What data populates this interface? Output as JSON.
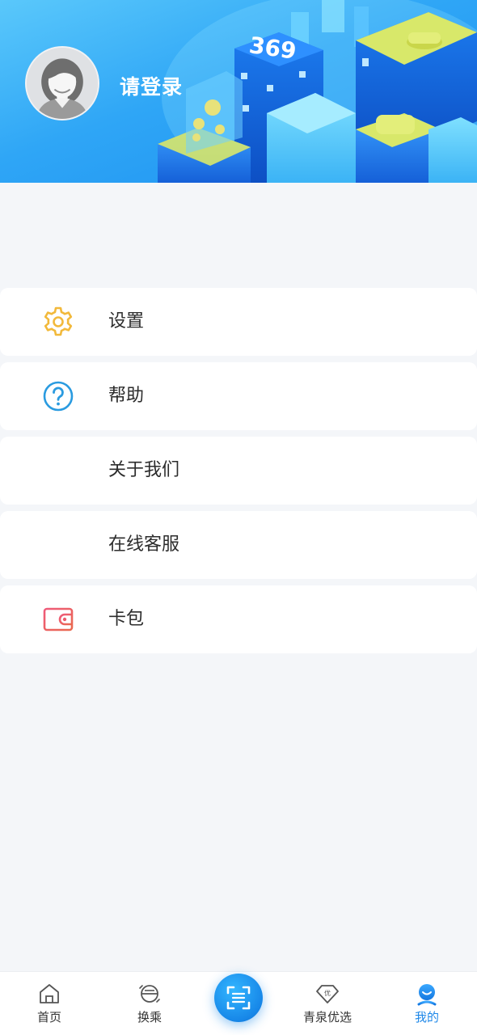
{
  "header": {
    "login_text": "请登录",
    "building_number": "369"
  },
  "menu": {
    "items": [
      {
        "label": "设置",
        "icon": "gear-icon",
        "color": "#f2b93b"
      },
      {
        "label": "帮助",
        "icon": "help-circle-icon",
        "color": "#2a9be0"
      },
      {
        "label": "关于我们",
        "icon": "",
        "color": ""
      },
      {
        "label": "在线客服",
        "icon": "",
        "color": ""
      },
      {
        "label": "卡包",
        "icon": "wallet-icon",
        "color": "#e5546c"
      }
    ]
  },
  "bottom_nav": {
    "items": [
      {
        "label": "首页",
        "icon": "home-icon",
        "active": false
      },
      {
        "label": "换乘",
        "icon": "transfer-icon",
        "active": false
      },
      {
        "label": "青泉优选",
        "icon": "diamond-icon",
        "active": false
      },
      {
        "label": "我的",
        "icon": "profile-icon",
        "active": true
      }
    ],
    "scan_icon": "scan-icon",
    "active_color": "#1d87e8",
    "diamond_badge": "优"
  },
  "colors": {
    "accent": "#1d87e8",
    "background": "#f4f6f9"
  }
}
